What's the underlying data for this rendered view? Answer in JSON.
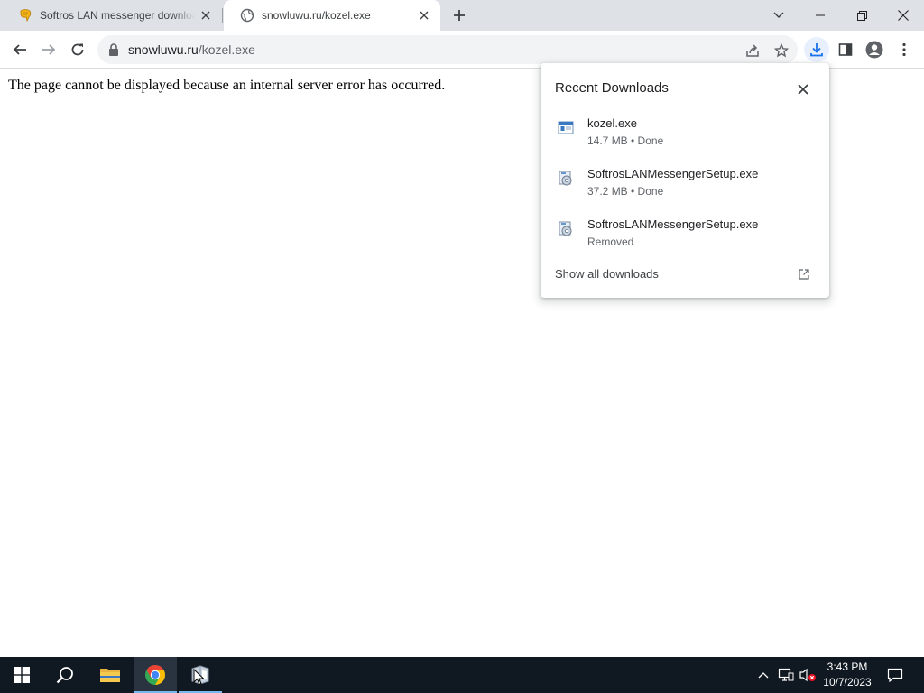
{
  "browser": {
    "tabs": [
      {
        "title": "Softros LAN messenger downloa",
        "active": false
      },
      {
        "title": "snowluwu.ru/kozel.exe",
        "active": true
      }
    ],
    "address_bar": {
      "host": "snowluwu.ru",
      "path": "/kozel.exe"
    }
  },
  "page": {
    "message": "The page cannot be displayed because an internal server error has occurred."
  },
  "downloads_panel": {
    "title": "Recent Downloads",
    "items": [
      {
        "name": "kozel.exe",
        "status": "14.7 MB • Done",
        "icon": "exe-window-icon"
      },
      {
        "name": "SoftrosLANMessengerSetup.exe",
        "status": "37.2 MB • Done",
        "icon": "installer-icon"
      },
      {
        "name": "SoftrosLANMessengerSetup.exe",
        "status": "Removed",
        "icon": "installer-icon"
      }
    ],
    "show_all_label": "Show all downloads"
  },
  "taskbar": {
    "clock_time": "3:43 PM",
    "clock_date": "10/7/2023"
  },
  "colors": {
    "tabstrip": "#dee1e6",
    "accent": "#1a73e8",
    "taskbar": "#101821",
    "chrome_red": "#ea4335",
    "chrome_green": "#34a853",
    "chrome_yellow": "#fbbc05"
  }
}
